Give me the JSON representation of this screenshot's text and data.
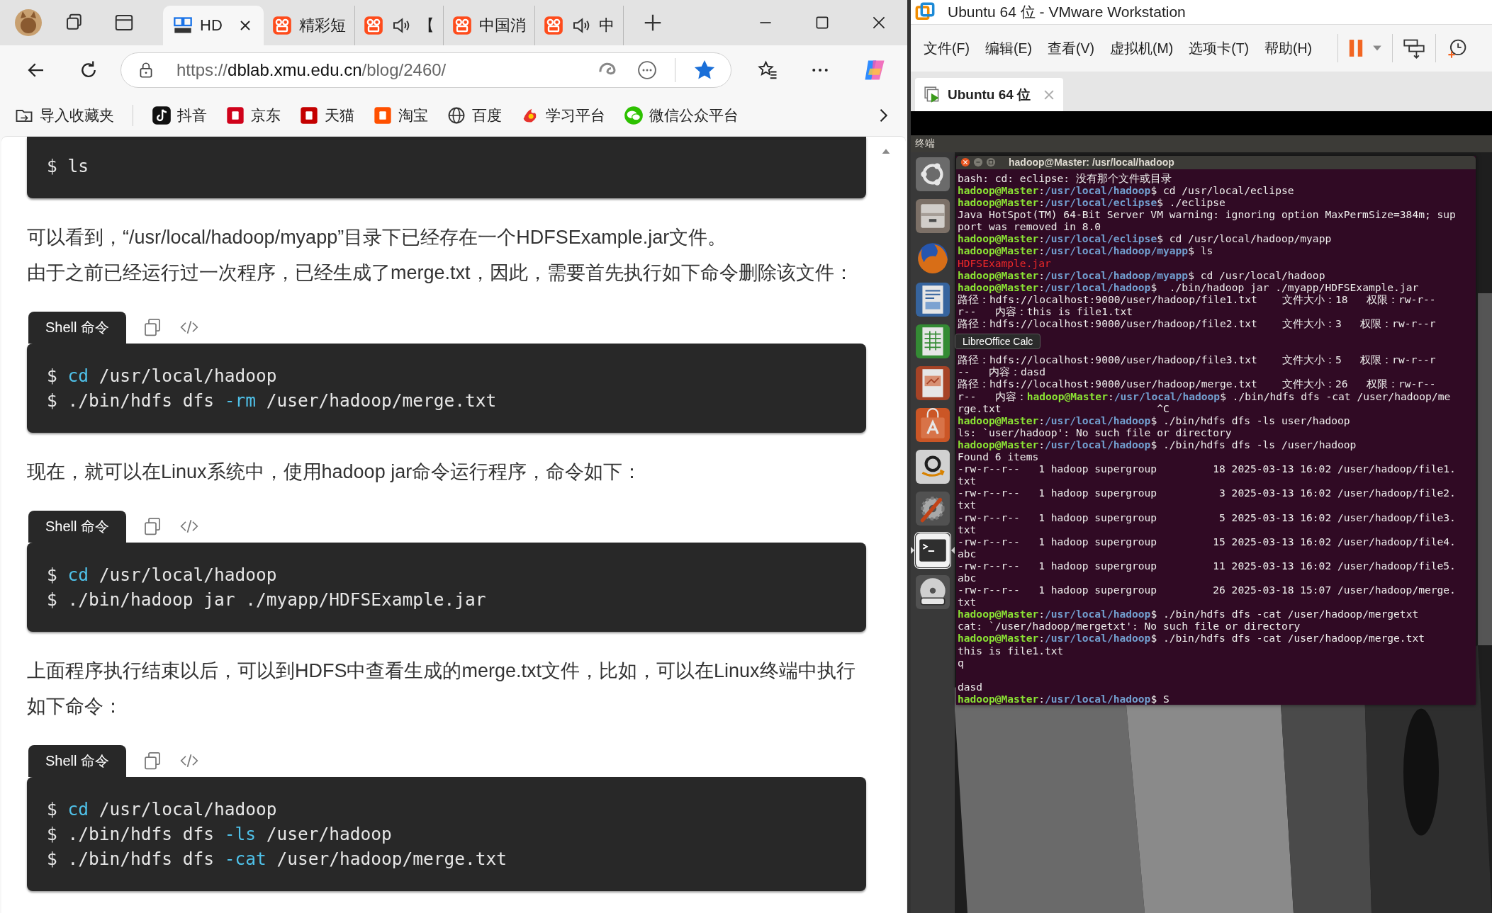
{
  "browser": {
    "tabs": [
      {
        "title": "HD",
        "kind": "dblab",
        "audio": false,
        "selected": true
      },
      {
        "title": "精彩短",
        "kind": "video",
        "audio": false,
        "selected": false
      },
      {
        "title": "【",
        "kind": "video",
        "audio": true,
        "selected": false
      },
      {
        "title": "中国消",
        "kind": "video",
        "audio": false,
        "selected": false
      },
      {
        "title": "中",
        "kind": "video",
        "audio": true,
        "selected": false
      }
    ],
    "url_parts": [
      "https://",
      "dblab.xmu.edu.cn",
      "/blog/2460/"
    ],
    "favorited": true,
    "bookmarks": [
      {
        "label": "导入收藏夹",
        "kind": "import"
      },
      {
        "label": "抖音",
        "kind": "note"
      },
      {
        "label": "京东",
        "kind": "jd"
      },
      {
        "label": "天猫",
        "kind": "tmall"
      },
      {
        "label": "淘宝",
        "kind": "taobao"
      },
      {
        "label": "百度",
        "kind": "globe"
      },
      {
        "label": "学习平台",
        "kind": "study"
      },
      {
        "label": "微信公众平台",
        "kind": "wechat"
      }
    ],
    "article": [
      {
        "kind": "code",
        "lines": [
          [
            {
              "t": "$ ls",
              "kind": "plain"
            }
          ]
        ]
      },
      {
        "kind": "paragraph",
        "lines": [
          "可以看到，“/usr/local/hadoop/myapp”目录下已经存在一个HDFSExample.jar文件。",
          "由于之前已经运行过一次程序，已经生成了merge.txt，因此，需要首先执行如下命令删除该文件："
        ]
      },
      {
        "kind": "code",
        "label": "Shell 命令",
        "lines": [
          [
            {
              "t": "$ ",
              "kind": "plain"
            },
            {
              "t": "cd",
              "kind": "keyword"
            },
            {
              "t": " /usr/local/hadoop",
              "kind": "plain"
            }
          ],
          [
            {
              "t": "$ ./bin/hdfs dfs ",
              "kind": "plain"
            },
            {
              "t": "-rm",
              "kind": "keyword"
            },
            {
              "t": " /user/hadoop/merge.txt",
              "kind": "plain"
            }
          ]
        ]
      },
      {
        "kind": "paragraph",
        "lines": [
          "现在，就可以在Linux系统中，使用hadoop jar命令运行程序，命令如下："
        ]
      },
      {
        "kind": "code",
        "label": "Shell 命令",
        "lines": [
          [
            {
              "t": "$ ",
              "kind": "plain"
            },
            {
              "t": "cd",
              "kind": "keyword"
            },
            {
              "t": " /usr/local/hadoop",
              "kind": "plain"
            }
          ],
          [
            {
              "t": "$ ./bin/hadoop jar ./myapp/HDFSExample.jar",
              "kind": "plain"
            }
          ]
        ]
      },
      {
        "kind": "paragraph",
        "lines": [
          "上面程序执行结束以后，可以到HDFS中查看生成的merge.txt文件，比如，可以在Linux终端中执行如下命令："
        ]
      },
      {
        "kind": "code",
        "label": "Shell 命令",
        "lines": [
          [
            {
              "t": "$ ",
              "kind": "plain"
            },
            {
              "t": "cd",
              "kind": "keyword"
            },
            {
              "t": " /usr/local/hadoop",
              "kind": "plain"
            }
          ],
          [
            {
              "t": "$ ./bin/hdfs dfs ",
              "kind": "plain"
            },
            {
              "t": "-ls",
              "kind": "keyword"
            },
            {
              "t": " /user/hadoop",
              "kind": "plain"
            }
          ],
          [
            {
              "t": "$ ./bin/hdfs dfs ",
              "kind": "plain"
            },
            {
              "t": "-cat",
              "kind": "keyword"
            },
            {
              "t": " /user/hadoop/merge.txt",
              "kind": "plain"
            }
          ]
        ]
      }
    ]
  },
  "vmware": {
    "title": "Ubuntu 64 位 - VMware Workstation",
    "menu": [
      "文件(F)",
      "编辑(E)",
      "查看(V)",
      "虚拟机(M)",
      "选项卡(T)",
      "帮助(H)"
    ],
    "vm_tab": {
      "title": "Ubuntu 64 位",
      "selected": true
    },
    "panel_title": "终端",
    "launcher": [
      {
        "kind": "dash",
        "active": false
      },
      {
        "kind": "files",
        "active": false
      },
      {
        "kind": "firefox",
        "active": false
      },
      {
        "kind": "writer",
        "active": false
      },
      {
        "kind": "calc",
        "active": false
      },
      {
        "kind": "impress",
        "active": false
      },
      {
        "kind": "software",
        "active": false
      },
      {
        "kind": "amazon",
        "active": false
      },
      {
        "kind": "settings",
        "active": false
      },
      {
        "kind": "terminal",
        "active": true
      },
      {
        "kind": "dvd",
        "active": false
      }
    ],
    "tooltip": "LibreOffice Calc",
    "terminal": {
      "title": "hadoop@Master: /usr/local/hadoop",
      "lines": [
        {
          "kind": "text",
          "segments": [
            {
              "t": "bash: cd: eclipse: 没有那个文件或目录",
              "kind": "text"
            }
          ]
        },
        {
          "kind": "text",
          "segments": [
            {
              "t": "hadoop@Master",
              "kind": "user"
            },
            {
              "t": ":",
              "kind": "text"
            },
            {
              "t": "/usr/local/hadoop",
              "kind": "path"
            },
            {
              "t": "$ cd /usr/local/eclipse",
              "kind": "text"
            }
          ]
        },
        {
          "kind": "text",
          "segments": [
            {
              "t": "hadoop@Master",
              "kind": "user"
            },
            {
              "t": ":",
              "kind": "text"
            },
            {
              "t": "/usr/local/eclipse",
              "kind": "path"
            },
            {
              "t": "$ ./eclipse",
              "kind": "text"
            }
          ]
        },
        {
          "kind": "text",
          "segments": [
            {
              "t": "Java HotSpot(TM) 64-Bit Server VM warning: ignoring option MaxPermSize=384m; sup",
              "kind": "text"
            }
          ]
        },
        {
          "kind": "text",
          "segments": [
            {
              "t": "port was removed in 8.0",
              "kind": "text"
            }
          ]
        },
        {
          "kind": "text",
          "segments": [
            {
              "t": "hadoop@Master",
              "kind": "user"
            },
            {
              "t": ":",
              "kind": "text"
            },
            {
              "t": "/usr/local/eclipse",
              "kind": "path"
            },
            {
              "t": "$ cd /usr/local/hadoop/myapp",
              "kind": "text"
            }
          ]
        },
        {
          "kind": "text",
          "segments": [
            {
              "t": "hadoop@Master",
              "kind": "user"
            },
            {
              "t": ":",
              "kind": "text"
            },
            {
              "t": "/usr/local/hadoop/myapp",
              "kind": "path"
            },
            {
              "t": "$ ls",
              "kind": "text"
            }
          ]
        },
        {
          "kind": "text",
          "segments": [
            {
              "t": "HDFSExample.jar",
              "kind": "error"
            }
          ]
        },
        {
          "kind": "text",
          "segments": [
            {
              "t": "hadoop@Master",
              "kind": "user"
            },
            {
              "t": ":",
              "kind": "text"
            },
            {
              "t": "/usr/local/hadoop/myapp",
              "kind": "path"
            },
            {
              "t": "$ cd /usr/local/hadoop",
              "kind": "text"
            }
          ]
        },
        {
          "kind": "text",
          "segments": [
            {
              "t": "hadoop@Master",
              "kind": "user"
            },
            {
              "t": ":",
              "kind": "text"
            },
            {
              "t": "/usr/local/hadoop",
              "kind": "path"
            },
            {
              "t": "$  ./bin/hadoop jar ./myapp/HDFSExample.jar",
              "kind": "text"
            }
          ]
        },
        {
          "kind": "text",
          "segments": [
            {
              "t": "路径：hdfs://localhost:9000/user/hadoop/file1.txt    文件大小：18   权限：rw-r--",
              "kind": "text"
            }
          ]
        },
        {
          "kind": "text",
          "segments": [
            {
              "t": "r--   内容：this is file1.txt",
              "kind": "text"
            }
          ]
        },
        {
          "kind": "text",
          "segments": [
            {
              "t": "路径：hdfs://localhost:9000/user/hadoop/file2.txt    文件大小：3   权限：rw-r--r",
              "kind": "text"
            }
          ]
        },
        {
          "kind": "blank"
        },
        {
          "kind": "blank"
        },
        {
          "kind": "text",
          "segments": [
            {
              "t": "路径：hdfs://localhost:9000/user/hadoop/file3.txt    文件大小：5   权限：rw-r--r",
              "kind": "text"
            }
          ]
        },
        {
          "kind": "text",
          "segments": [
            {
              "t": "--   内容：dasd",
              "kind": "text"
            }
          ]
        },
        {
          "kind": "text",
          "segments": [
            {
              "t": "路径：hdfs://localhost:9000/user/hadoop/merge.txt    文件大小：26   权限：rw-r--",
              "kind": "text"
            }
          ]
        },
        {
          "kind": "text",
          "segments": [
            {
              "t": "r--   内容：",
              "kind": "text"
            },
            {
              "t": "hadoop@Master",
              "kind": "user"
            },
            {
              "t": ":",
              "kind": "text"
            },
            {
              "t": "/usr/local/hadoop",
              "kind": "path"
            },
            {
              "t": "$ ./bin/hdfs dfs -cat /user/hadoop/me",
              "kind": "text"
            }
          ]
        },
        {
          "kind": "text",
          "segments": [
            {
              "t": "rge.txt                         ^C",
              "kind": "text"
            }
          ]
        },
        {
          "kind": "text",
          "segments": [
            {
              "t": "hadoop@Master",
              "kind": "user"
            },
            {
              "t": ":",
              "kind": "text"
            },
            {
              "t": "/usr/local/hadoop",
              "kind": "path"
            },
            {
              "t": "$ ./bin/hdfs dfs -ls user/hadoop",
              "kind": "text"
            }
          ]
        },
        {
          "kind": "text",
          "segments": [
            {
              "t": "ls: `user/hadoop': No such file or directory",
              "kind": "text"
            }
          ]
        },
        {
          "kind": "text",
          "segments": [
            {
              "t": "hadoop@Master",
              "kind": "user"
            },
            {
              "t": ":",
              "kind": "text"
            },
            {
              "t": "/usr/local/hadoop",
              "kind": "path"
            },
            {
              "t": "$ ./bin/hdfs dfs -ls /user/hadoop",
              "kind": "text"
            }
          ]
        },
        {
          "kind": "text",
          "segments": [
            {
              "t": "Found 6 items",
              "kind": "text"
            }
          ]
        },
        {
          "kind": "text",
          "segments": [
            {
              "t": "-rw-r--r--   1 hadoop supergroup         18 2025-03-13 16:02 /user/hadoop/file1.",
              "kind": "text"
            }
          ]
        },
        {
          "kind": "text",
          "segments": [
            {
              "t": "txt",
              "kind": "text"
            }
          ]
        },
        {
          "kind": "text",
          "segments": [
            {
              "t": "-rw-r--r--   1 hadoop supergroup          3 2025-03-13 16:02 /user/hadoop/file2.",
              "kind": "text"
            }
          ]
        },
        {
          "kind": "text",
          "segments": [
            {
              "t": "txt",
              "kind": "text"
            }
          ]
        },
        {
          "kind": "text",
          "segments": [
            {
              "t": "-rw-r--r--   1 hadoop supergroup          5 2025-03-13 16:02 /user/hadoop/file3.",
              "kind": "text"
            }
          ]
        },
        {
          "kind": "text",
          "segments": [
            {
              "t": "txt",
              "kind": "text"
            }
          ]
        },
        {
          "kind": "text",
          "segments": [
            {
              "t": "-rw-r--r--   1 hadoop supergroup         15 2025-03-13 16:02 /user/hadoop/file4.",
              "kind": "text"
            }
          ]
        },
        {
          "kind": "text",
          "segments": [
            {
              "t": "abc",
              "kind": "text"
            }
          ]
        },
        {
          "kind": "text",
          "segments": [
            {
              "t": "-rw-r--r--   1 hadoop supergroup         11 2025-03-13 16:02 /user/hadoop/file5.",
              "kind": "text"
            }
          ]
        },
        {
          "kind": "text",
          "segments": [
            {
              "t": "abc",
              "kind": "text"
            }
          ]
        },
        {
          "kind": "text",
          "segments": [
            {
              "t": "-rw-r--r--   1 hadoop supergroup         26 2025-03-18 15:07 /user/hadoop/merge.",
              "kind": "text"
            }
          ]
        },
        {
          "kind": "text",
          "segments": [
            {
              "t": "txt",
              "kind": "text"
            }
          ]
        },
        {
          "kind": "text",
          "segments": [
            {
              "t": "hadoop@Master",
              "kind": "user"
            },
            {
              "t": ":",
              "kind": "text"
            },
            {
              "t": "/usr/local/hadoop",
              "kind": "path"
            },
            {
              "t": "$ ./bin/hdfs dfs -cat /user/hadoop/mergetxt",
              "kind": "text"
            }
          ]
        },
        {
          "kind": "text",
          "segments": [
            {
              "t": "cat: `/user/hadoop/mergetxt': No such file or directory",
              "kind": "text"
            }
          ]
        },
        {
          "kind": "text",
          "segments": [
            {
              "t": "hadoop@Master",
              "kind": "user"
            },
            {
              "t": ":",
              "kind": "text"
            },
            {
              "t": "/usr/local/hadoop",
              "kind": "path"
            },
            {
              "t": "$ ./bin/hdfs dfs -cat /user/hadoop/merge.txt",
              "kind": "text"
            }
          ]
        },
        {
          "kind": "text",
          "segments": [
            {
              "t": "this is file1.txt",
              "kind": "text"
            }
          ]
        },
        {
          "kind": "text",
          "segments": [
            {
              "t": "q",
              "kind": "text"
            }
          ]
        },
        {
          "kind": "blank"
        },
        {
          "kind": "text",
          "segments": [
            {
              "t": "dasd",
              "kind": "text"
            }
          ]
        },
        {
          "kind": "text",
          "segments": [
            {
              "t": "hadoop@Master",
              "kind": "user"
            },
            {
              "t": ":",
              "kind": "text"
            },
            {
              "t": "/usr/local/hadoop",
              "kind": "path"
            },
            {
              "t": "$ S",
              "kind": "text"
            }
          ]
        }
      ]
    }
  }
}
